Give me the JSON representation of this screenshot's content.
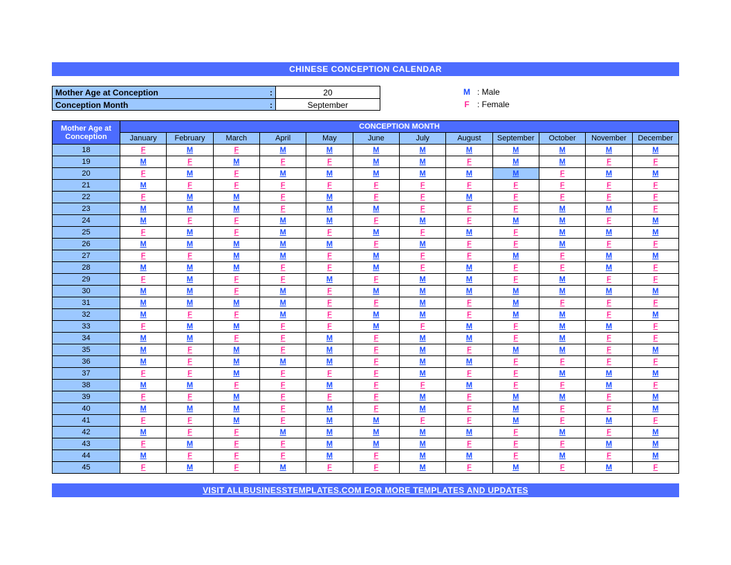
{
  "title": "CHINESE CONCEPTION CALENDAR",
  "params": {
    "age_label": "Mother Age at Conception",
    "month_label": "Conception Month",
    "colon": ":",
    "age_value": "20",
    "month_value": "September"
  },
  "legend": {
    "male_key": "M",
    "male_label": ": Male",
    "female_key": "F",
    "female_label": ": Female"
  },
  "table": {
    "age_header": "Mother Age at Conception",
    "month_group_header": "CONCEPTION MONTH",
    "months": [
      "January",
      "February",
      "March",
      "April",
      "May",
      "June",
      "July",
      "August",
      "September",
      "October",
      "November",
      "December"
    ]
  },
  "selected": {
    "age": 20,
    "month_index": 8
  },
  "chart_data": {
    "type": "table",
    "title": "Chinese Conception Calendar — predicted gender (M/F) by mother age and conception month",
    "row_label": "Mother Age at Conception",
    "col_label": "Conception Month",
    "columns": [
      "January",
      "February",
      "March",
      "April",
      "May",
      "June",
      "July",
      "August",
      "September",
      "October",
      "November",
      "December"
    ],
    "rows": [
      {
        "age": 18,
        "v": [
          "F",
          "M",
          "F",
          "M",
          "M",
          "M",
          "M",
          "M",
          "M",
          "M",
          "M",
          "M"
        ]
      },
      {
        "age": 19,
        "v": [
          "M",
          "F",
          "M",
          "F",
          "F",
          "M",
          "M",
          "F",
          "M",
          "M",
          "F",
          "F"
        ]
      },
      {
        "age": 20,
        "v": [
          "F",
          "M",
          "F",
          "M",
          "M",
          "M",
          "M",
          "M",
          "M",
          "F",
          "M",
          "M"
        ]
      },
      {
        "age": 21,
        "v": [
          "M",
          "F",
          "F",
          "F",
          "F",
          "F",
          "F",
          "F",
          "F",
          "F",
          "F",
          "F"
        ]
      },
      {
        "age": 22,
        "v": [
          "F",
          "M",
          "M",
          "F",
          "M",
          "F",
          "F",
          "M",
          "F",
          "F",
          "F",
          "F"
        ]
      },
      {
        "age": 23,
        "v": [
          "M",
          "M",
          "M",
          "F",
          "M",
          "M",
          "F",
          "F",
          "F",
          "M",
          "M",
          "F"
        ]
      },
      {
        "age": 24,
        "v": [
          "M",
          "F",
          "F",
          "M",
          "M",
          "F",
          "M",
          "F",
          "M",
          "M",
          "F",
          "M"
        ]
      },
      {
        "age": 25,
        "v": [
          "F",
          "M",
          "F",
          "M",
          "F",
          "M",
          "F",
          "M",
          "F",
          "M",
          "M",
          "M"
        ]
      },
      {
        "age": 26,
        "v": [
          "M",
          "M",
          "M",
          "M",
          "M",
          "F",
          "M",
          "F",
          "F",
          "M",
          "F",
          "F"
        ]
      },
      {
        "age": 27,
        "v": [
          "F",
          "F",
          "M",
          "M",
          "F",
          "M",
          "F",
          "F",
          "M",
          "F",
          "M",
          "M"
        ]
      },
      {
        "age": 28,
        "v": [
          "M",
          "M",
          "M",
          "F",
          "F",
          "M",
          "F",
          "M",
          "F",
          "F",
          "M",
          "F"
        ]
      },
      {
        "age": 29,
        "v": [
          "F",
          "M",
          "F",
          "F",
          "M",
          "F",
          "M",
          "M",
          "F",
          "M",
          "F",
          "F"
        ]
      },
      {
        "age": 30,
        "v": [
          "M",
          "M",
          "F",
          "M",
          "F",
          "M",
          "M",
          "M",
          "M",
          "M",
          "M",
          "M"
        ]
      },
      {
        "age": 31,
        "v": [
          "M",
          "M",
          "M",
          "M",
          "F",
          "F",
          "M",
          "F",
          "M",
          "F",
          "F",
          "F"
        ]
      },
      {
        "age": 32,
        "v": [
          "M",
          "F",
          "F",
          "M",
          "F",
          "M",
          "M",
          "F",
          "M",
          "M",
          "F",
          "M"
        ]
      },
      {
        "age": 33,
        "v": [
          "F",
          "M",
          "M",
          "F",
          "F",
          "M",
          "F",
          "M",
          "F",
          "M",
          "M",
          "F"
        ]
      },
      {
        "age": 34,
        "v": [
          "M",
          "M",
          "F",
          "F",
          "M",
          "F",
          "M",
          "M",
          "F",
          "M",
          "F",
          "F"
        ]
      },
      {
        "age": 35,
        "v": [
          "M",
          "F",
          "M",
          "F",
          "M",
          "F",
          "M",
          "F",
          "M",
          "M",
          "F",
          "M"
        ]
      },
      {
        "age": 36,
        "v": [
          "M",
          "F",
          "M",
          "M",
          "M",
          "F",
          "M",
          "M",
          "F",
          "F",
          "F",
          "F"
        ]
      },
      {
        "age": 37,
        "v": [
          "F",
          "F",
          "M",
          "F",
          "F",
          "F",
          "M",
          "F",
          "F",
          "M",
          "M",
          "M"
        ]
      },
      {
        "age": 38,
        "v": [
          "M",
          "M",
          "F",
          "F",
          "M",
          "F",
          "F",
          "M",
          "F",
          "F",
          "M",
          "F"
        ]
      },
      {
        "age": 39,
        "v": [
          "F",
          "F",
          "M",
          "F",
          "F",
          "F",
          "M",
          "F",
          "M",
          "M",
          "F",
          "M"
        ]
      },
      {
        "age": 40,
        "v": [
          "M",
          "M",
          "M",
          "F",
          "M",
          "F",
          "M",
          "F",
          "M",
          "F",
          "F",
          "M"
        ]
      },
      {
        "age": 41,
        "v": [
          "F",
          "F",
          "M",
          "F",
          "M",
          "M",
          "F",
          "F",
          "M",
          "F",
          "M",
          "F"
        ]
      },
      {
        "age": 42,
        "v": [
          "M",
          "F",
          "F",
          "M",
          "M",
          "M",
          "M",
          "M",
          "F",
          "M",
          "F",
          "M"
        ]
      },
      {
        "age": 43,
        "v": [
          "F",
          "M",
          "F",
          "F",
          "M",
          "M",
          "M",
          "F",
          "F",
          "F",
          "M",
          "M"
        ]
      },
      {
        "age": 44,
        "v": [
          "M",
          "F",
          "F",
          "F",
          "M",
          "F",
          "M",
          "M",
          "F",
          "M",
          "F",
          "M"
        ]
      },
      {
        "age": 45,
        "v": [
          "F",
          "M",
          "F",
          "M",
          "F",
          "F",
          "M",
          "F",
          "M",
          "F",
          "M",
          "F"
        ]
      }
    ]
  },
  "footer": "VISIT ALLBUSINESSTEMPLATES.COM FOR MORE TEMPLATES AND UPDATES"
}
